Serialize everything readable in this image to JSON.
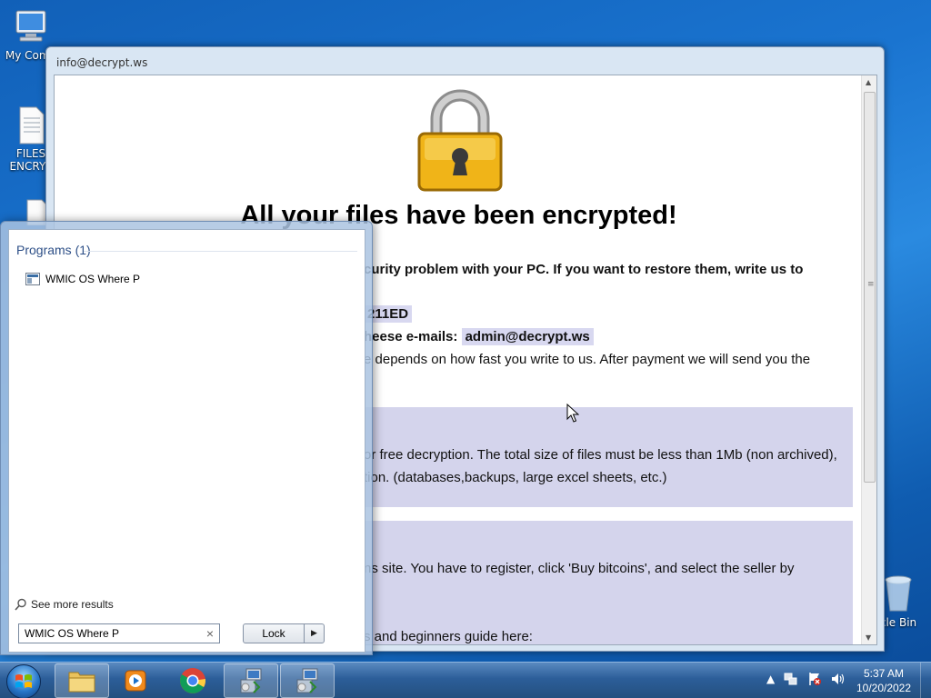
{
  "desktop": {
    "icons": [
      {
        "label": "My Comp",
        "icon": "computer-icon"
      },
      {
        "label": "FILES\nENCRYP",
        "icon": "document-icon"
      },
      {
        "label": "",
        "icon": "document-icon"
      },
      {
        "label": "cle Bin",
        "icon": "recycle-bin-icon"
      }
    ]
  },
  "window": {
    "title": "info@decrypt.ws",
    "headline": "All your files have been encrypted!",
    "line1": "curity problem with your PC. If you want to restore them, write us to",
    "id_fragment": "211ED",
    "emails_prefix": "heese e-mails:",
    "email": "admin@decrypt.ws",
    "line3": "e depends on how fast you write to us. After payment we will send you the",
    "panel1_line1": "or free decryption. The total size of files must be less than 1Mb (non archived),",
    "panel1_line2": "tion. (databases,backups, large excel sheets, etc.)",
    "panel2_line1": "ns site. You have to register, click 'Buy bitcoins', and select the seller by",
    "panel2_line2": "s and beginners guide here:"
  },
  "start_menu": {
    "section_title": "Programs (1)",
    "program_item": "WMIC OS Where P",
    "see_more": "See more results",
    "search_value": "WMIC OS Where P",
    "lock_label": "Lock",
    "clear_symbol": "×"
  },
  "taskbar": {
    "time": "5:37 AM",
    "date": "10/20/2022"
  },
  "colors": {
    "accent": "#2d4f87",
    "panel": "#d4d4ec",
    "highlight": "#d8d8f0"
  }
}
